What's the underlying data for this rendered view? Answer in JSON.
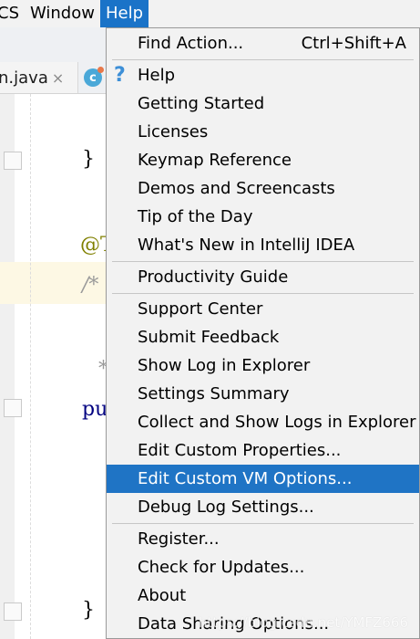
{
  "menubar": {
    "items": [
      {
        "label": "CS"
      },
      {
        "label": "Window"
      },
      {
        "label": "Help"
      }
    ]
  },
  "tabs": [
    {
      "label": "n.java",
      "close": "×"
    },
    {
      "label": "c"
    }
  ],
  "editor": {
    "tokens": [
      "}",
      "@T",
      "/*",
      "*",
      "pu",
      "}"
    ]
  },
  "help_menu": {
    "items": [
      {
        "label": "Find Action...",
        "shortcut": "Ctrl+Shift+A"
      },
      {
        "label": "Help"
      },
      {
        "label": "Getting Started"
      },
      {
        "label": "Licenses"
      },
      {
        "label": "Keymap Reference"
      },
      {
        "label": "Demos and Screencasts"
      },
      {
        "label": "Tip of the Day"
      },
      {
        "label": "What's New in IntelliJ IDEA"
      },
      {
        "label": "Productivity Guide"
      },
      {
        "label": "Support Center"
      },
      {
        "label": "Submit Feedback"
      },
      {
        "label": "Show Log in Explorer"
      },
      {
        "label": "Settings Summary"
      },
      {
        "label": "Collect and Show Logs in Explorer"
      },
      {
        "label": "Edit Custom Properties..."
      },
      {
        "label": "Edit Custom VM Options...",
        "selected": true
      },
      {
        "label": "Debug Log Settings..."
      },
      {
        "label": "Register..."
      },
      {
        "label": "Check for Updates..."
      },
      {
        "label": "About"
      },
      {
        "label": "Data Sharing Options..."
      }
    ],
    "help_icon": "?"
  },
  "watermark": "https://blog.csdn.net/YMFZ666",
  "colors": {
    "selection": "#1f74c5",
    "menubar_active": "#1a73c8",
    "annotation": "#808000",
    "keyword": "#000080"
  }
}
